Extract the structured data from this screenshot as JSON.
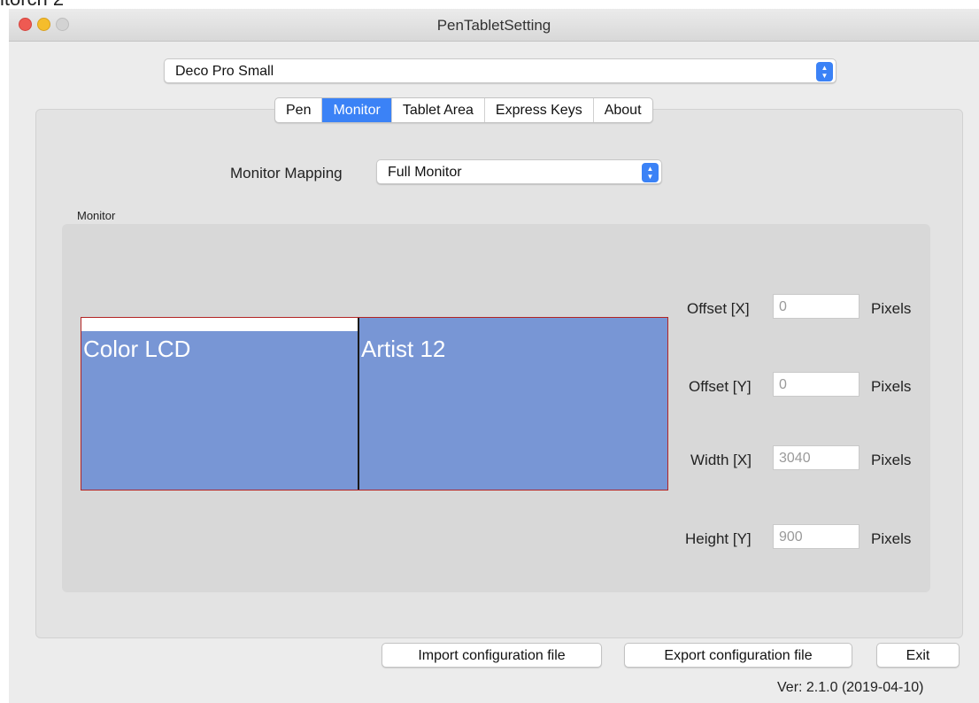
{
  "window": {
    "title": "PenTabletSetting"
  },
  "clipped_heading": "itorch 2",
  "device": {
    "selected": "Deco Pro Small"
  },
  "tabs": [
    {
      "label": "Pen"
    },
    {
      "label": "Monitor"
    },
    {
      "label": "Tablet Area"
    },
    {
      "label": "Express Keys"
    },
    {
      "label": "About"
    }
  ],
  "active_tab": "Monitor",
  "monitor_mapping": {
    "label": "Monitor Mapping",
    "selected": "Full Monitor"
  },
  "group_label": "Monitor",
  "monitors": [
    {
      "name": "Color LCD"
    },
    {
      "name": "Artist 12"
    }
  ],
  "fields": {
    "offset_x": {
      "label": "Offset [X]",
      "value": "0",
      "unit": "Pixels"
    },
    "offset_y": {
      "label": "Offset [Y]",
      "value": "0",
      "unit": "Pixels"
    },
    "width_x": {
      "label": "Width [X]",
      "value": "3040",
      "unit": "Pixels"
    },
    "height_y": {
      "label": "Height [Y]",
      "value": "900",
      "unit": "Pixels"
    }
  },
  "buttons": {
    "import": "Import configuration file",
    "export": "Export configuration file",
    "exit": "Exit"
  },
  "version": "Ver: 2.1.0 (2019-04-10)",
  "colors": {
    "accent": "#3b82f6",
    "monitor_fill": "#7896d5",
    "monitor_border": "#b32424"
  }
}
